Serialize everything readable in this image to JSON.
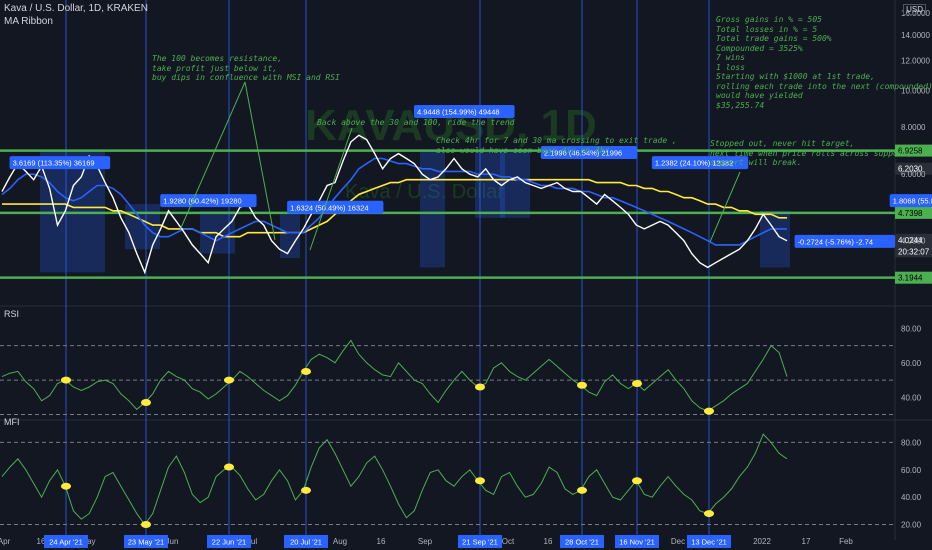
{
  "header": {
    "symbol_line": "Kava / U.S. Dollar, 1D, KRAKEN",
    "indicator": "MA Ribbon",
    "currency": "USD",
    "watermark": "KAVAUSD, 1D",
    "watermark_sub": "Kava / U.S. Dollar"
  },
  "notes": {
    "resistance": "The 100 becomes resistance,\ntake profit just below it,\nbuy dips in confluence with MSI and RSI",
    "back_above": "Back above the 30 and 100, ride the trend",
    "check_4hr": "Check 4hr for 7 and 30 ma crossing to exit trade ,\nalso would have seen bear div on 4hr",
    "stopped": "Stopped out, never hit target,\nnext time when price rolls across support,\nsupport will break.",
    "summary": "Gross gains in % = 505\nTotal losses in % = 5\nTotal trade gains = 500%\nCompounded = 3525%\n7 wins\n1 loss\nStarting with $1000 at 1st trade,\nrolling each trade into the next (compounded)\nwould have yielded\n$35,255.74"
  },
  "colors": {
    "background": "#131722",
    "price": "#ffffff",
    "ma_fast": "#2962ff",
    "ma_slow": "#ffeb3b",
    "support": "#4caf50",
    "annotation": "#2962ff",
    "indicator_line": "#4caf50",
    "marker": "#ffeb3b"
  },
  "chart_data": [
    {
      "type": "line",
      "title": "Kava / U.S. Dollar, 1D, KRAKEN",
      "scale": "log",
      "ylim": [
        3.0,
        16.5
      ],
      "y_ticks": [
        "16.0000",
        "14.0000",
        "12.0000",
        "10.0000",
        "8.0000",
        "6.0000",
        "4.0000"
      ],
      "x_ticks": [
        "Apr",
        "16",
        "May",
        "Jun",
        "Jul",
        "Aug",
        "16",
        "Sep",
        "Oct",
        "16",
        "Dec",
        "2022",
        "17",
        "Feb"
      ],
      "x_tick_positions": [
        4,
        41,
        88,
        172,
        252,
        340,
        381,
        425,
        508,
        548,
        678,
        762,
        806,
        846
      ],
      "price": [
        5.4,
        5.9,
        6.4,
        6.1,
        5.8,
        6.3,
        5.5,
        4.4,
        4.8,
        5.6,
        5.9,
        6.7,
        6.3,
        5.7,
        5.2,
        4.6,
        4.2,
        3.7,
        3.3,
        3.9,
        4.3,
        4.8,
        4.5,
        4.2,
        3.9,
        3.7,
        3.5,
        4.1,
        4.3,
        4.5,
        4.9,
        5.0,
        4.6,
        4.4,
        4.0,
        3.8,
        3.7,
        4.0,
        4.3,
        4.7,
        5.1,
        5.6,
        5.7,
        6.5,
        7.3,
        7.6,
        7.4,
        6.8,
        6.2,
        6.6,
        6.8,
        6.6,
        6.4,
        6.0,
        5.8,
        5.9,
        6.2,
        6.6,
        6.2,
        6.0,
        5.9,
        6.2,
        5.8,
        5.6,
        5.8,
        5.9,
        5.7,
        5.6,
        5.5,
        5.6,
        5.7,
        5.5,
        5.4,
        5.4,
        5.2,
        5.0,
        5.3,
        5.1,
        4.9,
        4.7,
        4.4,
        4.3,
        4.4,
        4.5,
        4.4,
        4.2,
        4.0,
        3.7,
        3.5,
        3.4,
        3.5,
        3.6,
        3.7,
        3.8,
        4.0,
        4.3,
        4.7,
        4.4,
        4.1,
        4.0
      ],
      "ma_fast": [
        5.3,
        5.5,
        5.8,
        6.0,
        6.0,
        5.9,
        5.7,
        5.4,
        5.2,
        5.1,
        5.2,
        5.4,
        5.6,
        5.6,
        5.5,
        5.3,
        5.0,
        4.7,
        4.4,
        4.2,
        4.1,
        4.1,
        4.2,
        4.3,
        4.3,
        4.2,
        4.1,
        4.0,
        4.1,
        4.2,
        4.3,
        4.4,
        4.5,
        4.5,
        4.4,
        4.3,
        4.2,
        4.2,
        4.2,
        4.4,
        4.6,
        4.9,
        5.2,
        5.5,
        5.8,
        6.2,
        6.4,
        6.6,
        6.6,
        6.5,
        6.4,
        6.4,
        6.3,
        6.2,
        6.2,
        6.1,
        6.1,
        6.1,
        6.1,
        6.1,
        6.0,
        6.0,
        6.0,
        5.9,
        5.9,
        5.8,
        5.8,
        5.7,
        5.6,
        5.6,
        5.5,
        5.5,
        5.5,
        5.4,
        5.4,
        5.3,
        5.2,
        5.2,
        5.1,
        5.0,
        4.9,
        4.8,
        4.7,
        4.6,
        4.5,
        4.4,
        4.3,
        4.2,
        4.1,
        4.0,
        3.9,
        3.9,
        3.9,
        3.9,
        4.0,
        4.1,
        4.2,
        4.3,
        4.3,
        4.3
      ],
      "ma_slow": [
        5.0,
        5.0,
        5.0,
        5.0,
        5.0,
        5.0,
        5.0,
        5.0,
        5.0,
        4.9,
        4.9,
        4.9,
        4.9,
        4.9,
        4.8,
        4.8,
        4.7,
        4.6,
        4.5,
        4.4,
        4.4,
        4.3,
        4.3,
        4.3,
        4.3,
        4.2,
        4.2,
        4.2,
        4.1,
        4.1,
        4.1,
        4.2,
        4.2,
        4.2,
        4.2,
        4.2,
        4.2,
        4.2,
        4.2,
        4.3,
        4.4,
        4.5,
        4.7,
        4.9,
        5.1,
        5.3,
        5.4,
        5.5,
        5.6,
        5.7,
        5.7,
        5.8,
        5.8,
        5.8,
        5.8,
        5.8,
        5.8,
        5.8,
        5.8,
        5.8,
        5.8,
        5.8,
        5.8,
        5.8,
        5.8,
        5.8,
        5.8,
        5.8,
        5.8,
        5.8,
        5.8,
        5.8,
        5.8,
        5.8,
        5.8,
        5.7,
        5.7,
        5.7,
        5.7,
        5.6,
        5.6,
        5.5,
        5.5,
        5.4,
        5.4,
        5.3,
        5.2,
        5.2,
        5.1,
        5.0,
        5.0,
        4.9,
        4.9,
        4.8,
        4.8,
        4.7,
        4.7,
        4.7,
        4.6,
        4.6
      ],
      "levels": [
        {
          "label": "6.9258",
          "value": 6.9258,
          "color": "#4caf50"
        },
        {
          "label": "4.7398",
          "value": 4.7398,
          "color": "#4caf50"
        },
        {
          "label": "3.1944",
          "value": 3.1944,
          "color": "#4caf50"
        }
      ],
      "price_tags": [
        {
          "label": "6.2030",
          "value": 6.203,
          "color": "#ffffff"
        },
        {
          "label": "4.0244",
          "value": 4.0244,
          "color": "#ffffff"
        },
        {
          "label": "20:32:07",
          "value": 3.75,
          "color": "#ffffff"
        }
      ],
      "trade_labels": [
        {
          "text": "3.6169 (113.35%) 36169",
          "x": 6,
          "y": 6.3
        },
        {
          "text": "1.9280 (60.42%) 19280",
          "x": 25,
          "y": 5.0
        },
        {
          "text": "1.6324 (50.49%) 16324",
          "x": 41,
          "y": 4.8
        },
        {
          "text": "4.9448 (154.99%) 49448",
          "x": 57,
          "y": 8.6
        },
        {
          "text": "2.1996 (46.54%) 21996",
          "x": 73,
          "y": 6.7
        },
        {
          "text": "1.2382 (24.10%) 12382",
          "x": 87,
          "y": 6.3
        },
        {
          "text": "-0.2724 (-5.76%) -2.74",
          "x": 105,
          "y": 3.9
        },
        {
          "text": "1.8068 (55.87%) 18068",
          "x": 117,
          "y": 5.0
        }
      ]
    },
    {
      "type": "line",
      "title": "RSI",
      "ylim": [
        28,
        86
      ],
      "y_ticks": [
        "80.00",
        "60.00",
        "40.00"
      ],
      "values": [
        52,
        54,
        55,
        49,
        45,
        38,
        41,
        48,
        50,
        46,
        44,
        46,
        49,
        50,
        48,
        42,
        38,
        33,
        37,
        42,
        50,
        55,
        52,
        50,
        45,
        43,
        39,
        42,
        46,
        50,
        55,
        52,
        48,
        44,
        41,
        38,
        41,
        47,
        55,
        62,
        65,
        63,
        60,
        67,
        73,
        65,
        60,
        56,
        53,
        52,
        60,
        55,
        50,
        48,
        42,
        37,
        44,
        50,
        55,
        50,
        46,
        48,
        57,
        60,
        55,
        52,
        50,
        54,
        58,
        62,
        58,
        54,
        50,
        47,
        43,
        41,
        49,
        53,
        48,
        45,
        48,
        44,
        48,
        52,
        56,
        50,
        45,
        38,
        34,
        32,
        35,
        38,
        42,
        45,
        48,
        55,
        62,
        70,
        66,
        52
      ],
      "markers": [
        10,
        22,
        37,
        54,
        75,
        91,
        111,
        122
      ],
      "dashed": [
        70,
        50,
        30
      ]
    },
    {
      "type": "line",
      "title": "MFI",
      "ylim": [
        16,
        92
      ],
      "y_ticks": [
        "80.00",
        "60.00",
        "40.00",
        "20.00"
      ],
      "values": [
        55,
        62,
        68,
        60,
        50,
        40,
        52,
        60,
        48,
        30,
        24,
        28,
        40,
        55,
        58,
        48,
        38,
        28,
        20,
        28,
        45,
        62,
        70,
        58,
        42,
        36,
        40,
        55,
        60,
        62,
        56,
        46,
        38,
        42,
        52,
        60,
        52,
        38,
        45,
        62,
        76,
        82,
        72,
        60,
        48,
        55,
        65,
        70,
        60,
        48,
        35,
        25,
        30,
        45,
        58,
        60,
        52,
        48,
        55,
        60,
        52,
        45,
        42,
        55,
        58,
        48,
        40,
        42,
        50,
        62,
        58,
        46,
        42,
        45,
        55,
        60,
        50,
        40,
        38,
        45,
        52,
        42,
        40,
        48,
        55,
        48,
        42,
        38,
        30,
        28,
        35,
        40,
        46,
        55,
        62,
        72,
        86,
        80,
        72,
        68
      ],
      "markers": [
        10,
        22,
        37,
        54,
        75,
        91,
        111,
        122
      ],
      "dashed": [
        80,
        20
      ]
    }
  ],
  "date_badges": [
    "24 Apr '21",
    "23 May '21",
    "22 Jun '21",
    "20 Jul '21",
    "21 Sep '21",
    "28 Oct '21",
    "16 Nov '21",
    "13 Dec '21"
  ],
  "date_badge_positions": [
    66,
    146,
    229,
    306,
    480,
    582,
    637,
    709
  ],
  "pane_labels": {
    "rsi": "RSI",
    "mfi": "MFI"
  }
}
